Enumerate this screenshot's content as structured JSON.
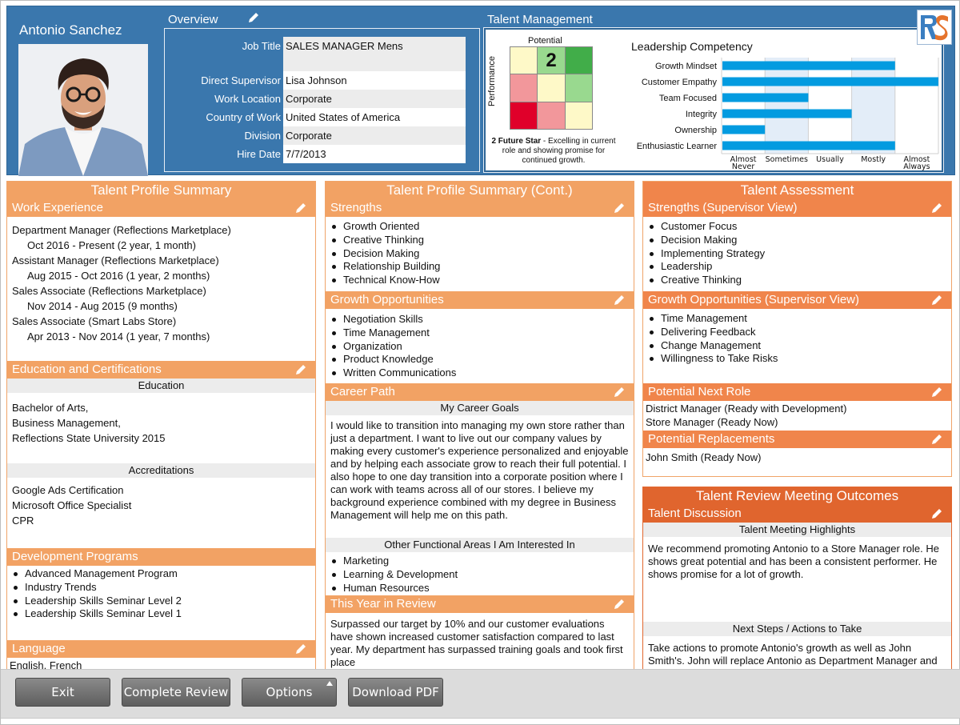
{
  "employee": {
    "name": "Antonio Sanchez",
    "photo_alt": "employee-photo"
  },
  "overview": {
    "title": "Overview",
    "fields": [
      {
        "label": "Job Title",
        "value": "SALES MANAGER Mens"
      },
      {
        "label": "Direct Supervisor",
        "value": "Lisa Johnson"
      },
      {
        "label": "Work Location",
        "value": "Corporate"
      },
      {
        "label": "Country of Work",
        "value": "United States of America"
      },
      {
        "label": "Division",
        "value": "Corporate"
      },
      {
        "label": "Hire Date",
        "value": "7/7/2013"
      }
    ]
  },
  "talent_management": {
    "title": "Talent Management",
    "logo_text": "RS",
    "ninebox": {
      "x_label": "Potential",
      "y_label": "Performance",
      "selected_box": "2",
      "cells": [
        {
          "color": "#fef9c8",
          "label": ""
        },
        {
          "color": "#99d98f",
          "label": "2"
        },
        {
          "color": "#41ad49",
          "label": ""
        },
        {
          "color": "#f2979b",
          "label": ""
        },
        {
          "color": "#fef9c8",
          "label": ""
        },
        {
          "color": "#99d98f",
          "label": ""
        },
        {
          "color": "#e0002a",
          "label": ""
        },
        {
          "color": "#f2979b",
          "label": ""
        },
        {
          "color": "#fef9c8",
          "label": ""
        }
      ],
      "caption_bold": "2 Future Star",
      "caption_rest": " - Excelling in current role and showing promise for continued growth."
    }
  },
  "chart_data": {
    "type": "bar",
    "orientation": "horizontal",
    "title": "Leadership Competency",
    "categories": [
      "Growth Mindset",
      "Customer Empathy",
      "Team Focused",
      "Integrity",
      "Ownership",
      "Enthusiastic Learner"
    ],
    "values": [
      4.0,
      5.0,
      2.0,
      3.0,
      1.0,
      4.0
    ],
    "xlabel": "",
    "ylabel": "",
    "x_ticks": [
      "Almost Never",
      "Sometimes",
      "Usually",
      "Mostly",
      "Almost Always"
    ],
    "xlim": [
      0,
      5
    ],
    "grid": true,
    "bar_color": "#039be0",
    "band_color": "#e3edf8"
  },
  "col1": {
    "title": "Talent Profile Summary",
    "work_experience": {
      "title": "Work Experience",
      "items": [
        {
          "role": "Department Manager (Reflections Marketplace)",
          "dates": "Oct 2016 - Present (2 year, 1 month)"
        },
        {
          "role": "Assistant Manager (Reflections Marketplace)",
          "dates": "Aug 2015 - Oct 2016 (1 year, 2 months)"
        },
        {
          "role": "Sales Associate (Reflections Marketplace)",
          "dates": "Nov 2014 - Aug 2015 (9 months)"
        },
        {
          "role": "Sales Associate (Smart Labs Store)",
          "dates": "Apr 2013 - Nov 2014 (1 year, 7 months)"
        }
      ]
    },
    "education": {
      "title": "Education and Certifications",
      "education_head": "Education",
      "education_lines": [
        "Bachelor of Arts,",
        "Business Management,",
        "Reflections State University 2015"
      ],
      "accreditations_head": "Accreditations",
      "accreditations": [
        "Google Ads Certification",
        "Microsoft Office Specialist",
        "CPR"
      ]
    },
    "development": {
      "title": "Development Programs",
      "items": [
        "Advanced Management Program",
        "Industry Trends",
        "Leadership Skills Seminar Level 2",
        "Leadership Skills Seminar Level 1"
      ]
    },
    "language": {
      "title": "Language",
      "value": "English, French"
    }
  },
  "col2": {
    "title": "Talent Profile Summary (Cont.)",
    "strengths": {
      "title": "Strengths",
      "items": [
        "Growth Oriented",
        "Creative Thinking",
        "Decision Making",
        "Relationship Building",
        "Technical Know-How"
      ]
    },
    "growth": {
      "title": "Growth Opportunities",
      "items": [
        "Negotiation Skills",
        "Time Management",
        "Organization",
        "Product Knowledge",
        "Written Communications"
      ]
    },
    "career": {
      "title": "Career Path",
      "goals_head": "My Career Goals",
      "goals_text": "I would like to transition into managing my own store rather than just a department. I want to live out our company values by making every customer's experience personalized and enjoyable and by helping each associate grow to reach their full potential. I also hope to one day transition into a corporate position where I can work with teams across all of our stores. I believe my background experience combined with my degree in Business Management will help me on this path.",
      "areas_head": "Other Functional Areas I Am Interested In",
      "areas": [
        "Marketing",
        "Learning & Development",
        "Human Resources"
      ]
    },
    "review": {
      "title": "This Year in Review",
      "text": "Surpassed our target by 10% and our customer evaluations have shown increased customer satisfaction compared to last year. My department has surpassed training goals and took first place"
    }
  },
  "col3": {
    "title": "Talent Assessment",
    "strengths": {
      "title": "Strengths (Supervisor View)",
      "items": [
        "Customer Focus",
        "Decision Making",
        "Implementing Strategy",
        "Leadership",
        "Creative Thinking"
      ]
    },
    "growth": {
      "title": "Growth Opportunities (Supervisor View)",
      "items": [
        "Time Management",
        "Delivering Feedback",
        "Change Management",
        "Willingness to Take Risks"
      ]
    },
    "next_role": {
      "title": "Potential Next Role",
      "items": [
        "District Manager (Ready with Development)",
        "Store Manager (Ready Now)"
      ]
    },
    "replacements": {
      "title": "Potential Replacements",
      "items": [
        "John Smith (Ready Now)"
      ]
    }
  },
  "col4": {
    "title": "Talent Review Meeting Outcomes",
    "discussion": {
      "title": "Talent Discussion",
      "highlights_head": "Talent Meeting Highlights",
      "highlights_text": "We recommend promoting Antonio to a Store Manager role. He shows great potential and has been a consistent performer. He shows promise for a lot of growth.",
      "next_head": "Next Steps / Actions to Take",
      "next_text": "Take actions to promote Antonio's growth as well as John Smith's. John will replace Antonio as Department Manager and Antonio"
    }
  },
  "footer": {
    "exit": "Exit",
    "complete": "Complete Review",
    "options": "Options",
    "pdf": "Download PDF"
  }
}
